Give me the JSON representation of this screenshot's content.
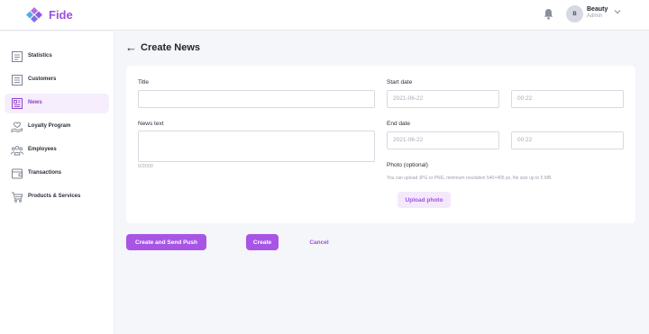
{
  "app": {
    "name": "Fide"
  },
  "user": {
    "initial": "B",
    "name": "Beauty",
    "role": "Admin"
  },
  "sidebar": {
    "items": [
      {
        "label": "Statistics",
        "icon": "statistics-icon",
        "active": false
      },
      {
        "label": "Customers",
        "icon": "customers-icon",
        "active": false
      },
      {
        "label": "News",
        "icon": "news-icon",
        "active": true
      },
      {
        "label": "Loyalty Program",
        "icon": "loyalty-icon",
        "active": false
      },
      {
        "label": "Employees",
        "icon": "employees-icon",
        "active": false
      },
      {
        "label": "Transactions",
        "icon": "transactions-icon",
        "active": false
      },
      {
        "label": "Products & Services",
        "icon": "cart-icon",
        "active": false
      }
    ]
  },
  "page": {
    "title": "Create News"
  },
  "form": {
    "title_label": "Title",
    "title_value": "",
    "news_text_label": "News text",
    "news_text_value": "",
    "news_text_counter": "0/2000",
    "start_date_label": "Start date",
    "start_date_value": "2021-06-22",
    "start_time_value": "00:22",
    "end_date_label": "End date",
    "end_date_value": "2021-06-22",
    "end_time_value": "00:22",
    "photo_label": "Photo (optional)",
    "photo_hint": "You can upload JPG or PNG, minimum resolution 540×405 px, file size up to 5 MB.",
    "upload_button": "Upload photo"
  },
  "actions": {
    "create_and_push": "Create and Send Push",
    "create": "Create",
    "cancel": "Cancel"
  },
  "colors": {
    "accent": "#9b51e0",
    "button": "#a855e6",
    "active_bg": "#f6eefc",
    "page_bg": "#f4f6f9"
  }
}
